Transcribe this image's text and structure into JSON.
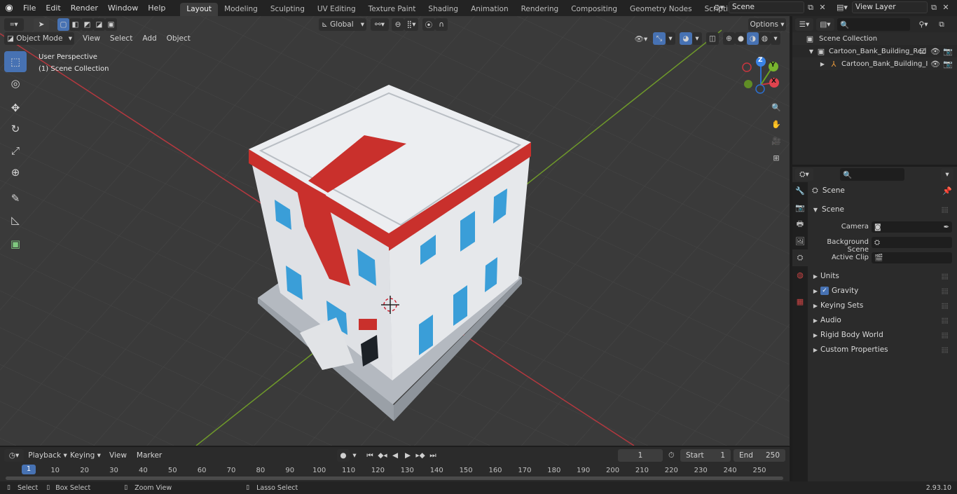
{
  "menu": {
    "items": [
      "File",
      "Edit",
      "Render",
      "Window",
      "Help"
    ]
  },
  "workspaces": {
    "tabs": [
      "Layout",
      "Modeling",
      "Sculpting",
      "UV Editing",
      "Texture Paint",
      "Shading",
      "Animation",
      "Rendering",
      "Compositing",
      "Geometry Nodes",
      "Scripting"
    ],
    "active": "Layout",
    "add_label": "+"
  },
  "scene_selector": {
    "value": "Scene"
  },
  "view_layer_selector": {
    "value": "View Layer"
  },
  "viewport": {
    "mode": "Object Mode",
    "menus": [
      "View",
      "Select",
      "Add",
      "Object"
    ],
    "transform_orientation": "Global",
    "options_label": "Options",
    "overlay_title": "User Perspective",
    "overlay_subtitle": "(1) Scene Collection",
    "gizmo_axes": {
      "x": "X",
      "y": "Y",
      "z": "Z"
    },
    "colors": {
      "bg": "#3a3a3a",
      "x_axis": "#b5383f",
      "y_axis": "#6f9a2a",
      "building_wall": "#e8e9ec",
      "building_trim": "#c9302c",
      "window": "#3a9ed8",
      "base": "#b3b8bf"
    }
  },
  "tools": [
    {
      "name": "select-box-tool",
      "glyph": "⬚",
      "active": true
    },
    {
      "name": "cursor-tool",
      "glyph": "◎",
      "active": false
    },
    {
      "name": "move-tool",
      "glyph": "✥",
      "active": false
    },
    {
      "name": "rotate-tool",
      "glyph": "↻",
      "active": false
    },
    {
      "name": "scale-tool",
      "glyph": "⤢",
      "active": false
    },
    {
      "name": "transform-tool",
      "glyph": "⊕",
      "active": false
    },
    {
      "name": "annotate-tool",
      "glyph": "✎",
      "active": false
    },
    {
      "name": "measure-tool",
      "glyph": "📐",
      "active": false
    },
    {
      "name": "add-cube-tool",
      "glyph": "⬛",
      "active": false
    }
  ],
  "outliner": {
    "search_placeholder": "",
    "rows": [
      {
        "label": "Scene Collection",
        "indent": 0
      },
      {
        "label": "Cartoon_Bank_Building_Red",
        "indent": 1
      },
      {
        "label": "Cartoon_Bank_Building_I",
        "indent": 2
      }
    ]
  },
  "properties": {
    "context_title": "Scene",
    "panel_title": "Scene",
    "fields": [
      {
        "label": "Camera",
        "value": ""
      },
      {
        "label": "Background Scene",
        "value": ""
      },
      {
        "label": "Active Clip",
        "value": ""
      }
    ],
    "subpanels": [
      {
        "label": "Units",
        "checkbox": false
      },
      {
        "label": "Gravity",
        "checkbox": true
      },
      {
        "label": "Keying Sets",
        "checkbox": false
      },
      {
        "label": "Audio",
        "checkbox": false
      },
      {
        "label": "Rigid Body World",
        "checkbox": false
      },
      {
        "label": "Custom Properties",
        "checkbox": false
      }
    ]
  },
  "timeline": {
    "menus": [
      "Playback",
      "Keying",
      "View",
      "Marker"
    ],
    "current_frame": "1",
    "start_label": "Start",
    "start_value": "1",
    "end_label": "End",
    "end_value": "250",
    "ruler": [
      "10",
      "20",
      "30",
      "40",
      "50",
      "60",
      "70",
      "80",
      "90",
      "100",
      "110",
      "120",
      "130",
      "140",
      "150",
      "160",
      "170",
      "180",
      "190",
      "200",
      "210",
      "220",
      "230",
      "240",
      "250"
    ],
    "cursor_frame": "1"
  },
  "statusbar": {
    "items": [
      "Select",
      "Box Select",
      "Zoom View",
      "Lasso Select"
    ],
    "version": "2.93.10"
  }
}
